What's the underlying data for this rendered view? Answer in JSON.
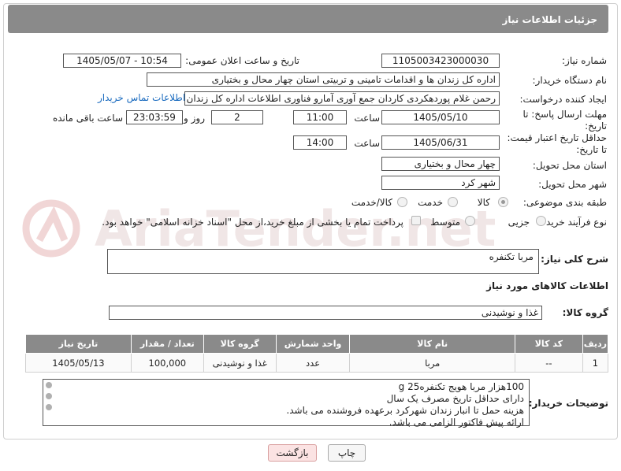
{
  "header": {
    "title": "جزئیات اطلاعات نیاز"
  },
  "labels": {
    "need_number": "شماره نیاز:",
    "announce_datetime": "تاریخ و ساعت اعلان عمومی:",
    "buyer_org": "نام دستگاه خریدار:",
    "requester": "ایجاد کننده درخواست:",
    "reply_deadline": "مهلت ارسال پاسخ: تا تاریخ:",
    "price_validity": "حداقل تاریخ اعتبار قیمت: تا تاریخ:",
    "hour": "ساعت",
    "day_and": "روز و",
    "remaining": "ساعت باقی مانده",
    "delivery_province": "استان محل تحویل:",
    "delivery_city": "شهر محل تحویل:",
    "category": "طبقه بندی موضوعی:",
    "process_type": "نوع فرآیند خرید :",
    "need_desc": "شرح کلی نیاز:",
    "goods_info": "اطلاعات کالاهای مورد نیاز",
    "goods_group": "گروه کالا:",
    "buyer_notes": "توضیحات خریدار:"
  },
  "values": {
    "need_number": "1105003423000030",
    "announce_datetime": "1405/05/07 - 10:54",
    "buyer_org": "اداره کل زندان ها و اقدامات تامینی و تربیتی استان چهار محال و بختیاری",
    "requester": "رحمن غلام پوردهکردی کاردان جمع آوری آمارو فناوری اطلاعات اداره کل زندان ها",
    "contact_link": "اطلاعات تماس خریدار",
    "reply_date": "1405/05/10",
    "reply_time": "11:00",
    "remaining_days": "2",
    "remaining_time": "23:03:59",
    "price_date": "1405/06/31",
    "price_time": "14:00",
    "province": "چهار محال و بختیاری",
    "city": "شهر کرد",
    "need_desc": "مربا تکنفره",
    "goods_group": "غذا و نوشیدنی"
  },
  "category_options": [
    "کالا",
    "خدمت",
    "کالا/خدمت"
  ],
  "category_selected": "کالا",
  "process_options": [
    "جزیی",
    "متوسط"
  ],
  "process_selected": "جزیی",
  "payment_note": "پرداخت تمام یا بخشی از مبلغ خرید،از محل \"اسناد خزانه اسلامی\" خواهد بود.",
  "table": {
    "headers": [
      "ردیف",
      "کد کالا",
      "نام کالا",
      "واحد شمارش",
      "گروه کالا",
      "تعداد / مقدار",
      "تاریخ نیاز"
    ],
    "rows": [
      [
        "1",
        "--",
        "مربا",
        "عدد",
        "غذا و نوشیدنی",
        "100,000",
        "1405/05/13"
      ]
    ]
  },
  "notes": [
    "100هزار مربا هویج تکنفره25 g",
    "دارای حداقل تاریخ مصرف یک سال",
    "هزینه حمل تا انبار زندان شهرکرد برعهده فروشنده می  باشد.",
    "ارائه پیش فاکتور الزامی می باشد."
  ],
  "buttons": {
    "print": "چاپ",
    "back": "بازگشت"
  },
  "watermark": "AriaTender.net"
}
